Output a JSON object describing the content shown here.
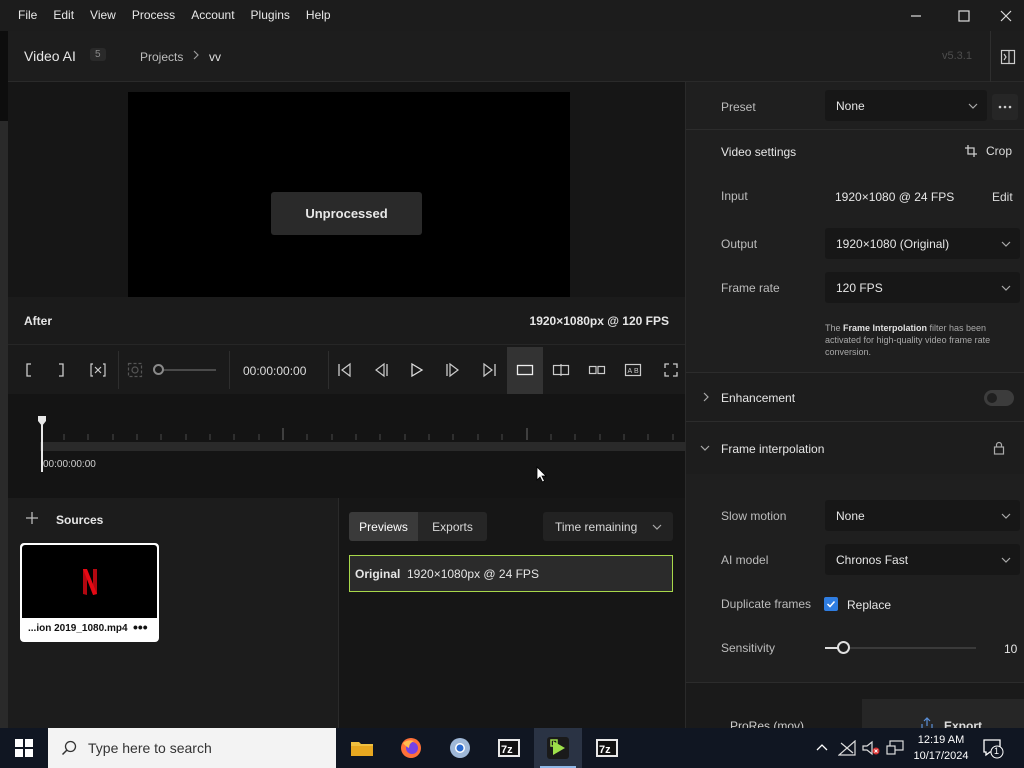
{
  "menu": [
    "File",
    "Edit",
    "View",
    "Process",
    "Account",
    "Plugins",
    "Help"
  ],
  "header": {
    "app_name": "Video AI",
    "badge": "5",
    "breadcrumb_projects": "Projects",
    "breadcrumb_current": "vv",
    "version": "v5.3.1"
  },
  "viewer": {
    "overlay": "Unprocessed",
    "side_label": "After",
    "resolution": "1920×1080px @ 120 FPS"
  },
  "transport": {
    "timecode": "00:00:00:00"
  },
  "timeline": {
    "time": "00:00:00:00"
  },
  "sources": {
    "title": "Sources",
    "items": [
      {
        "name": "...ion 2019_1080.mp4",
        "more": "•••"
      }
    ]
  },
  "previews": {
    "tabs": [
      "Previews",
      "Exports"
    ],
    "sort": "Time remaining",
    "rows": [
      {
        "label": "Original",
        "detail": "1920×1080px @ 24 FPS"
      }
    ]
  },
  "settings": {
    "preset_label": "Preset",
    "preset_value": "None",
    "video_settings_title": "Video settings",
    "crop_label": "Crop",
    "input_label": "Input",
    "input_value": "1920×1080 @ 24 FPS",
    "edit_label": "Edit",
    "output_label": "Output",
    "output_value": "1920×1080 (Original)",
    "frame_rate_label": "Frame rate",
    "frame_rate_value": "120 FPS",
    "note_pre": "The ",
    "note_bold": "Frame Interpolation",
    "note_post": " filter has been activated for high-quality video frame rate conversion.",
    "enhancement_label": "Enhancement",
    "enhancement_enabled": false,
    "frame_interp_label": "Frame interpolation",
    "slow_motion_label": "Slow motion",
    "slow_motion_value": "None",
    "ai_model_label": "AI model",
    "ai_model_value": "Chronos Fast",
    "dup_frames_label": "Duplicate frames",
    "replace_label": "Replace",
    "replace_checked": true,
    "sensitivity_label": "Sensitivity",
    "sensitivity_value": "10",
    "format_label": "ProRes (mov)",
    "export_label": "Export"
  },
  "taskbar": {
    "search_placeholder": "Type here to search",
    "time": "12:19 AM",
    "date": "10/17/2024",
    "notif_count": "1"
  },
  "colors": {
    "accent_green": "#a8d84a",
    "checkbox_blue": "#2f7de1",
    "netflix_red": "#e50914"
  }
}
